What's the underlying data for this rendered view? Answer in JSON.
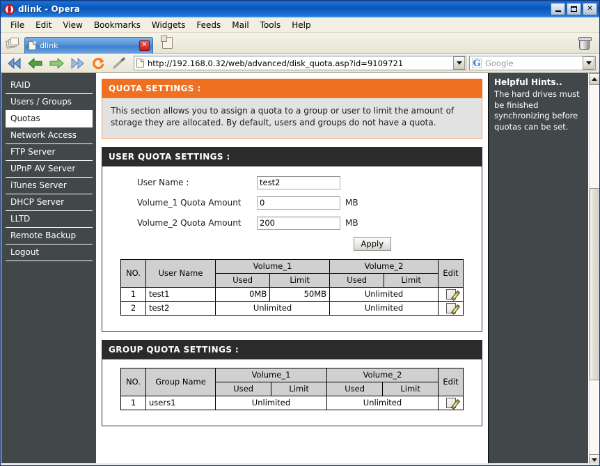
{
  "window": {
    "title": "dlink - Opera",
    "logo_icon": "opera-logo",
    "controls": [
      {
        "name": "minimize-button",
        "icon": "minimize-icon",
        "label": "_"
      },
      {
        "name": "maximize-button",
        "icon": "maximize-icon",
        "label": "□"
      },
      {
        "name": "close-button",
        "icon": "close-icon",
        "label": "✕"
      }
    ]
  },
  "menubar": {
    "items": [
      "File",
      "Edit",
      "View",
      "Bookmarks",
      "Widgets",
      "Feeds",
      "Mail",
      "Tools",
      "Help"
    ]
  },
  "tabbar": {
    "tab_stack_icon": "tab-stack-icon",
    "tab": {
      "title": "dlink",
      "page_icon": "page-icon",
      "close_label": "✕"
    },
    "new_tab_icon": "new-tab-icon",
    "trash_icon": "trash-icon"
  },
  "navbar": {
    "buttons": [
      {
        "name": "rewind-button",
        "icon": "rewind-icon",
        "color": "#4f82c8"
      },
      {
        "name": "back-button",
        "icon": "back-arrow-icon",
        "color": "#4f9c3a"
      },
      {
        "name": "forward-button",
        "icon": "forward-arrow-icon",
        "color": "#7ab85f"
      },
      {
        "name": "fast-forward-button",
        "icon": "fast-forward-icon",
        "color": "#7aa6d8"
      },
      {
        "name": "reload-button",
        "icon": "reload-icon",
        "color": "#e87a20"
      },
      {
        "name": "edit-page-button",
        "icon": "pencil-icon",
        "color": "#8a8a8a"
      }
    ],
    "url": "http://192.168.0.32/web/advanced/disk_quota.asp?id=9109721",
    "url_page_icon": "page-icon",
    "url_dropdown_icon": "chevron-down-icon",
    "search": {
      "engine_icon": "google-g-icon",
      "engine_letter": "G",
      "placeholder": "Google",
      "dropdown_icon": "chevron-down-icon"
    }
  },
  "sidebar": {
    "items": [
      {
        "label": "RAID",
        "active": false
      },
      {
        "label": "Users / Groups",
        "active": false
      },
      {
        "label": "Quotas",
        "active": true
      },
      {
        "label": "Network Access",
        "active": false
      },
      {
        "label": "FTP Server",
        "active": false
      },
      {
        "label": "UPnP AV Server",
        "active": false
      },
      {
        "label": "iTunes Server",
        "active": false
      },
      {
        "label": "DHCP Server",
        "active": false
      },
      {
        "label": "LLTD",
        "active": false
      },
      {
        "label": "Remote Backup",
        "active": false
      },
      {
        "label": "Logout",
        "active": false
      }
    ]
  },
  "main": {
    "quota_settings": {
      "header": "QUOTA SETTINGS :",
      "description": "This section allows you to assign a quota to a group or user to limit the amount of storage they are allocated. By default, users and groups do not have a quota.",
      "accent_color": "#f07022"
    },
    "user_quota_settings": {
      "header": "USER QUOTA SETTINGS :",
      "fields": [
        {
          "label": "User Name :",
          "value": "test2",
          "unit": ""
        },
        {
          "label": "Volume_1 Quota Amount",
          "value": "0",
          "unit": "MB"
        },
        {
          "label": "Volume_2 Quota Amount",
          "value": "200",
          "unit": "MB"
        }
      ],
      "apply_label": "Apply",
      "table": {
        "headers": {
          "no": "NO.",
          "name": "User Name",
          "volume_1": "Volume_1",
          "volume_2": "Volume_2",
          "used": "Used",
          "limit": "Limit",
          "edit": "Edit"
        },
        "rows": [
          {
            "no": "1",
            "name": "test1",
            "v1_merged": false,
            "v1_used": "0MB",
            "v1_limit": "50MB",
            "v1_text": "",
            "v2_merged": true,
            "v2_used": "",
            "v2_limit": "",
            "v2_text": "Unlimited",
            "edit_icon": "edit-icon"
          },
          {
            "no": "2",
            "name": "test2",
            "v1_merged": true,
            "v1_used": "",
            "v1_limit": "",
            "v1_text": "Unlimited",
            "v2_merged": true,
            "v2_used": "",
            "v2_limit": "",
            "v2_text": "Unlimited",
            "edit_icon": "edit-icon"
          }
        ]
      }
    },
    "group_quota_settings": {
      "header": "GROUP QUOTA SETTINGS :",
      "table": {
        "headers": {
          "no": "NO.",
          "name": "Group Name",
          "volume_1": "Volume_1",
          "volume_2": "Volume_2",
          "used": "Used",
          "limit": "Limit",
          "edit": "Edit"
        },
        "rows": [
          {
            "no": "1",
            "name": "users1",
            "v1_text": "Unlimited",
            "v2_text": "Unlimited",
            "edit_icon": "edit-icon"
          }
        ]
      }
    }
  },
  "hints": {
    "title": "Helpful Hints..",
    "body": "The hard drives must be finished synchronizing before quotas can be set."
  },
  "scrollbar": {
    "up_icon": "scroll-up-icon",
    "down_icon": "scroll-down-icon",
    "thumb": "scroll-thumb"
  }
}
